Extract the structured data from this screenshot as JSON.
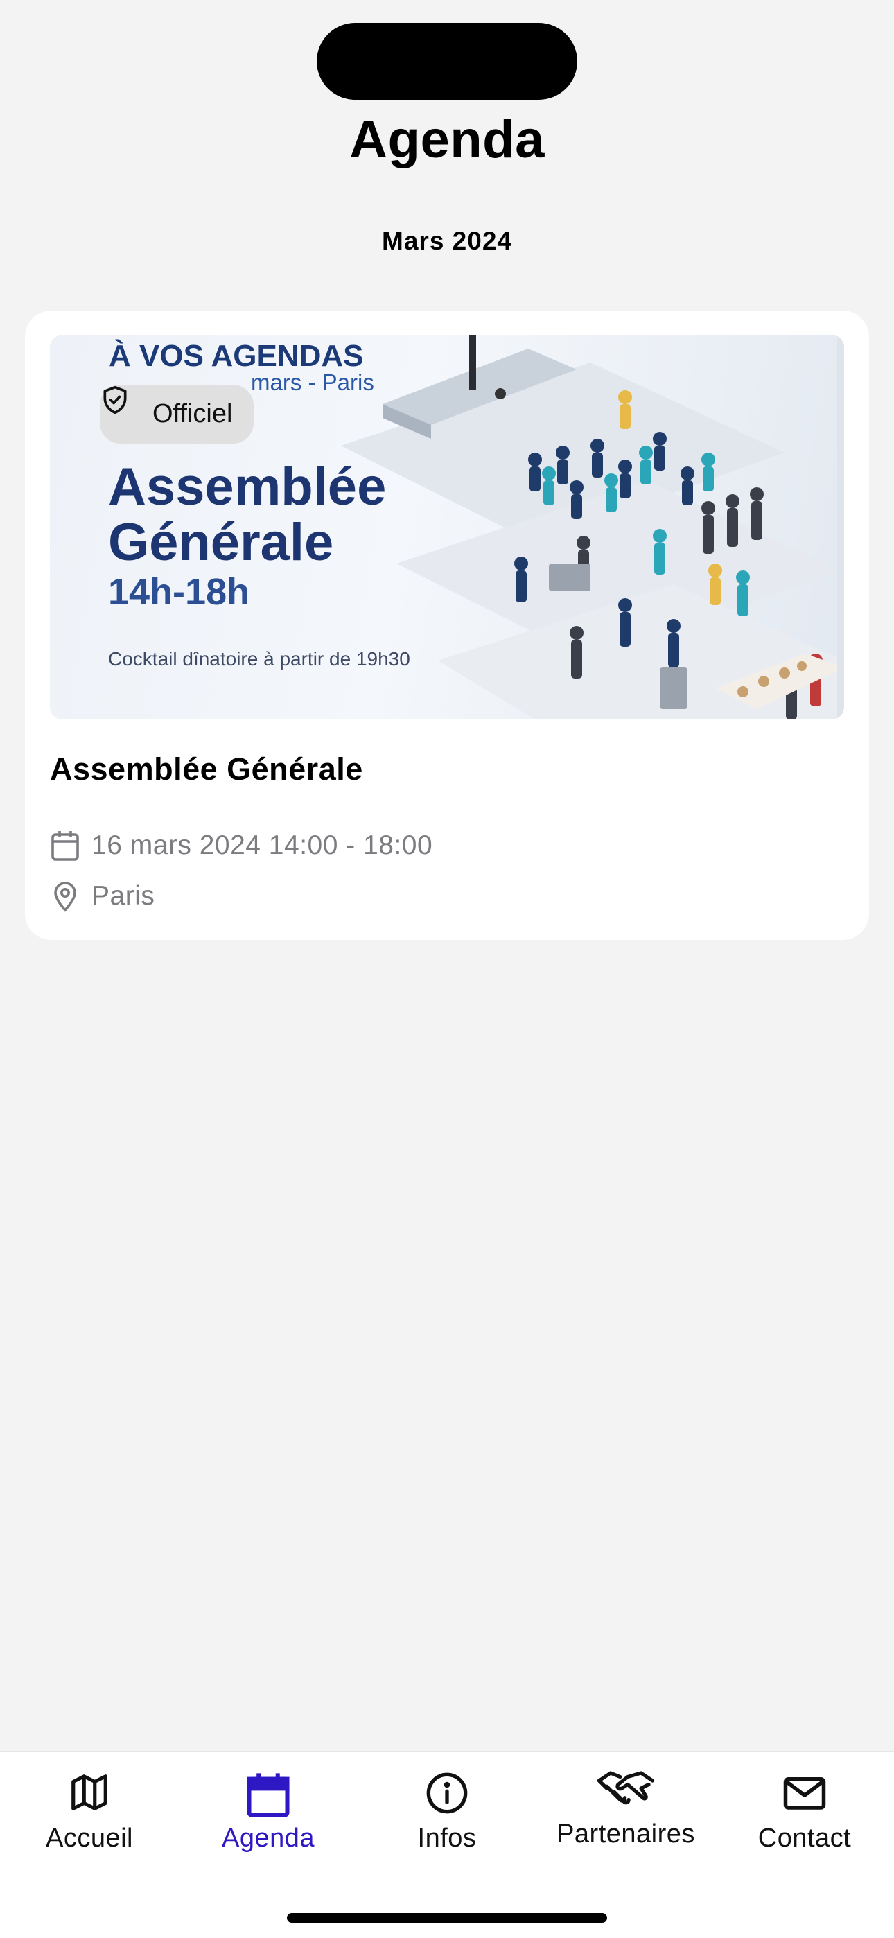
{
  "header": {
    "title": "Agenda"
  },
  "month": "Mars 2024",
  "event": {
    "badge": "Officiel",
    "title": "Assemblée Générale",
    "date": "16 mars 2024 14:00 - 18:00",
    "location": "Paris",
    "image": {
      "kicker": "À VOS AGENDAS",
      "subtitle": "mars - Paris",
      "title_line1": "Assemblée",
      "title_line2": "Générale",
      "hours": "14h-18h",
      "cocktail": "Cocktail dînatoire à partir de 19h30"
    }
  },
  "tabs": [
    {
      "label": "Accueil",
      "icon": "map-icon",
      "active": false
    },
    {
      "label": "Agenda",
      "icon": "calendar-icon",
      "active": true
    },
    {
      "label": "Infos",
      "icon": "info-icon",
      "active": false
    },
    {
      "label": "Partenaires",
      "icon": "handshake-icon",
      "active": false
    },
    {
      "label": "Contact",
      "icon": "mail-icon",
      "active": false
    }
  ],
  "colors": {
    "accent": "#2e18c4",
    "background": "#f3f3f3",
    "muted": "#7b7b80",
    "image_navy": "#1d3570"
  }
}
